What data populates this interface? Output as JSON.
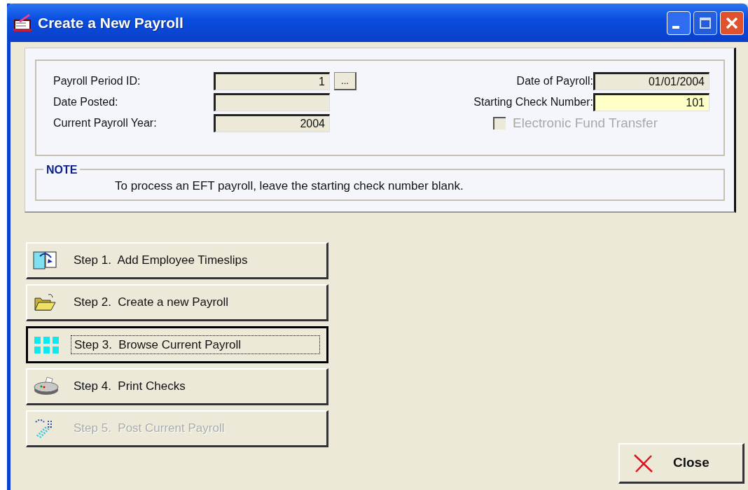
{
  "window": {
    "title": "Create a New Payroll"
  },
  "fields_left": [
    {
      "label": "Payroll Period ID:",
      "value": "1",
      "lookup_button": "...",
      "highlighted": false
    },
    {
      "label": "Date Posted:",
      "highlighted": false
    },
    {
      "label": "Current Payroll Year:",
      "value": "2004",
      "highlighted": false
    }
  ],
  "fields_right": [
    {
      "label": "Date of Payroll:",
      "value": "01/01/2004",
      "highlighted": false
    },
    {
      "label": "Starting Check Number:",
      "value": "101",
      "highlighted": true
    }
  ],
  "eft_checkbox": {
    "label": "Electronic Fund Transfer",
    "checked": false,
    "disabled": true
  },
  "note": {
    "title": "NOTE",
    "text": "To process an EFT payroll, leave the starting check number blank."
  },
  "steps": [
    {
      "label": "Step 1.  Add Employee Timeslips",
      "selected": false,
      "disabled": false
    },
    {
      "label": "Step 2.  Create a new Payroll",
      "selected": false,
      "disabled": false
    },
    {
      "label": "Step 3.  Browse Current Payroll",
      "selected": true,
      "disabled": false
    },
    {
      "label": "Step 4.  Print Checks",
      "selected": false,
      "disabled": false
    },
    {
      "label": "Step 5.  Post Current Payroll",
      "selected": false,
      "disabled": true
    }
  ],
  "close_button": {
    "label": "Close"
  }
}
